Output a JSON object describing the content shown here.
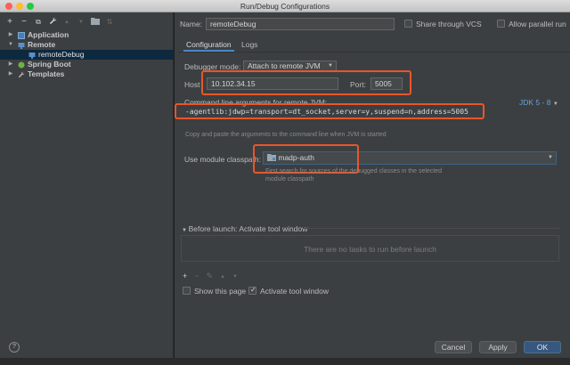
{
  "window": {
    "title": "Run/Debug Configurations"
  },
  "left_toolbar": {
    "icons": [
      "add-icon",
      "remove-icon",
      "copy-icon",
      "wrench-icon",
      "move-up-icon",
      "move-down-icon",
      "folder-icon",
      "sort-icon"
    ],
    "add": "+",
    "remove": "−",
    "copy": "⧉",
    "wrench": "🔧",
    "up": "▲",
    "down": "▼",
    "folder": "▆",
    "sort": "⇅"
  },
  "tree": {
    "application": "Application",
    "remote": "Remote",
    "remote_debug": "remoteDebug",
    "spring_boot": "Spring Boot",
    "templates": "Templates"
  },
  "name_label": "Name:",
  "name_value": "remoteDebug",
  "share_vcs": {
    "label": "Share through VCS",
    "checked": false
  },
  "allow_parallel": {
    "label": "Allow parallel run",
    "checked": false
  },
  "tabs": [
    {
      "label": "Configuration",
      "active": true
    },
    {
      "label": "Logs",
      "active": false
    }
  ],
  "debugger_mode": {
    "label": "Debugger mode:",
    "value": "Attach to remote JVM"
  },
  "host": {
    "label": "Host",
    "value": "10.102.34.15"
  },
  "port": {
    "label": "Port:",
    "value": "5005"
  },
  "cmd": {
    "label": "Command line arguments for remote JVM:",
    "jdk": "JDK 5 - 8",
    "value": "-agentlib:jdwp=transport=dt_socket,server=y,suspend=n,address=5005",
    "hint": "Copy and paste the arguments to the command line when JVM is started"
  },
  "module": {
    "label": "Use module classpath:",
    "value": "madp-auth",
    "hint1": "First search for sources of the debugged classes in the selected",
    "hint2": "module classpath"
  },
  "before_launch": {
    "label": "Before launch: Activate tool window",
    "empty": "There are no tasks to run before launch"
  },
  "show_page": {
    "label": "Show this page",
    "checked": false
  },
  "activate_tool": {
    "label": "Activate tool window",
    "checked": true
  },
  "buttons": {
    "help": "?",
    "cancel": "Cancel",
    "apply": "Apply",
    "ok": "OK"
  },
  "colors": {
    "accent": "#4a88c7",
    "highlight": "#e8562a",
    "selection": "#0d293e",
    "primary_button": "#365880"
  }
}
